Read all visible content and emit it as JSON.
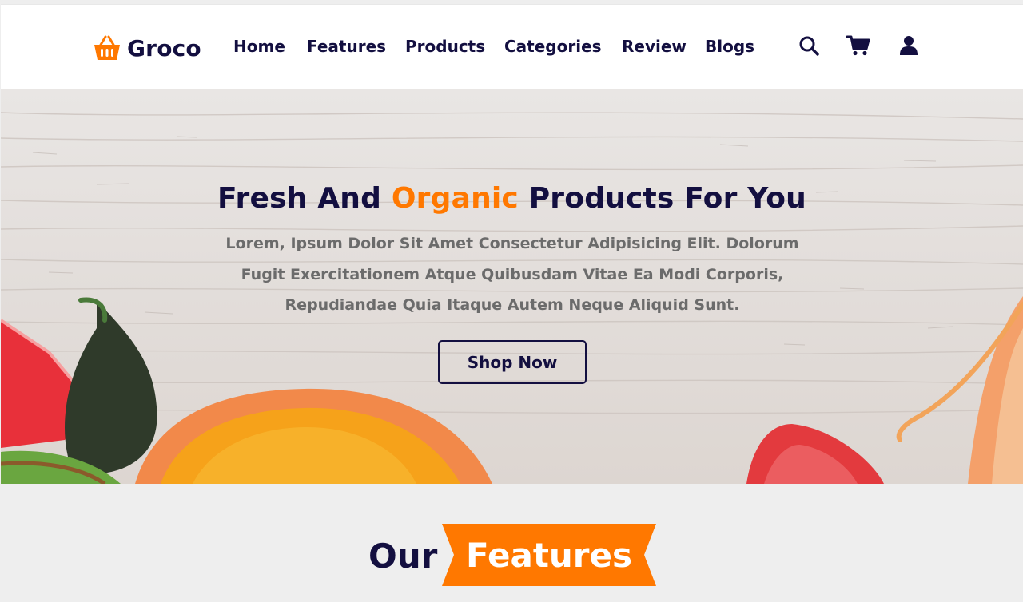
{
  "brand": {
    "name": "Groco",
    "icon": "basket-icon",
    "color": "#ff7800"
  },
  "nav": {
    "items": [
      "Home",
      "Features",
      "Products",
      "Categories",
      "Review",
      "Blogs"
    ]
  },
  "header_icons": [
    "search-icon",
    "cart-icon",
    "user-icon"
  ],
  "hero": {
    "title_before": "Fresh And",
    "title_accent": "Organic",
    "title_after": "Products For You",
    "description": "Lorem, Ipsum Dolor Sit Amet Consectetur Adipisicing Elit. Dolorum Fugit Exercitationem Atque Quibusdam Vitae Ea Modi Corporis, Repudiandae Quia Itaque Autem Neque Aliquid Sunt.",
    "cta_label": "Shop Now"
  },
  "features_heading": {
    "prefix": "Our",
    "highlight": "Features"
  },
  "colors": {
    "primary": "#130f40",
    "accent": "#ff7800",
    "text_muted": "#6b6b6b",
    "section_bg": "#eeeeee"
  }
}
